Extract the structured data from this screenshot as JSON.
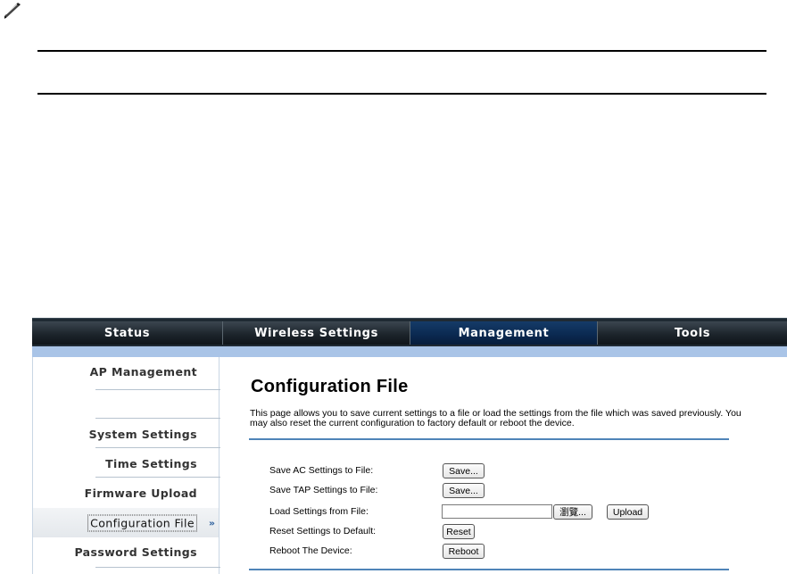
{
  "note": {
    "icon": "pencil-note-icon"
  },
  "nav": {
    "tabs": [
      {
        "label": "Status",
        "active": false
      },
      {
        "label": "Wireless Settings",
        "active": false
      },
      {
        "label": "Management",
        "active": true
      },
      {
        "label": "Tools",
        "active": false
      }
    ]
  },
  "sidebar": {
    "items": [
      {
        "label": "AP Management"
      },
      {
        "label": ""
      },
      {
        "label": "System Settings"
      },
      {
        "label": "Time Settings"
      },
      {
        "label": "Firmware Upload"
      },
      {
        "label": "Configuration File",
        "active": true
      },
      {
        "label": "Password Settings"
      }
    ],
    "active_marker": "»"
  },
  "content": {
    "title": "Configuration File",
    "description": "This page allows you to save current settings to a file or load the settings from the file which was saved previously. You may also reset the current configuration to factory default or reboot the device.",
    "rows": {
      "save_ac": {
        "label": "Save AC Settings to File:",
        "button": "Save..."
      },
      "save_tap": {
        "label": "Save TAP Settings to File:",
        "button": "Save..."
      },
      "load": {
        "label": "Load Settings from File:",
        "file_value": "",
        "browse_button": "瀏覽...",
        "upload_button": "Upload"
      },
      "reset": {
        "label": "Reset Settings to Default:",
        "button": "Reset"
      },
      "reboot": {
        "label": "Reboot The Device:",
        "button": "Reboot"
      }
    }
  },
  "colors": {
    "accent_blue": "#4f84b8",
    "nav_dark": "#1f2a33",
    "nav_active": "#0b2a52",
    "subbar": "#a9c4e7"
  }
}
